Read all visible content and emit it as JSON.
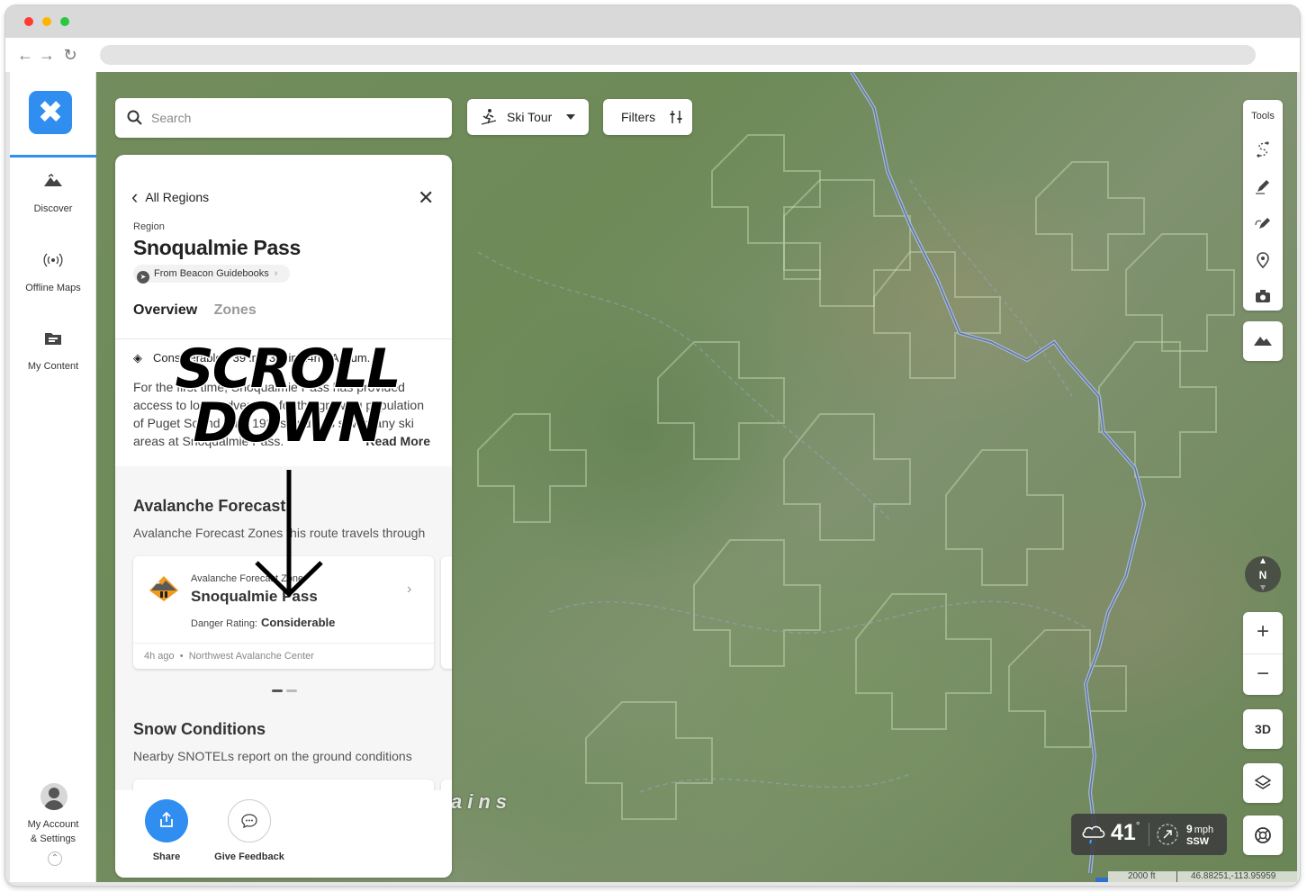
{
  "sidebar": {
    "items": [
      {
        "label": "Discover",
        "icon": "mountain-icon"
      },
      {
        "label": "Offline Maps",
        "icon": "signal-icon"
      },
      {
        "label": "My Content",
        "icon": "folder-icon"
      }
    ],
    "account_label_1": "My Account",
    "account_label_2": "& Settings"
  },
  "search": {
    "placeholder": "Search"
  },
  "activity_filter": {
    "label": "Ski Tour"
  },
  "filters": {
    "label": "Filters"
  },
  "panel": {
    "back_label": "All Regions",
    "region_caption": "Region",
    "title": "Snoqualmie Pass",
    "source": "From Beacon Guidebooks",
    "tabs": [
      {
        "label": "Overview"
      },
      {
        "label": "Zones"
      }
    ],
    "stats": {
      "danger": "Considerable",
      "snow": "39 in",
      "new_snow": "3.4 in 24h",
      "trend": "Accum."
    },
    "description": "For the first time, Snoqualmie Pass has provided access to local adventure for the growing population of Puget Sound. The 1920s and 30s saw many ski areas at Snoqualmie Pass.",
    "read_more": "Read More",
    "avalanche": {
      "title": "Avalanche Forecast",
      "subtitle": "Avalanche Forecast Zones this route travels through",
      "card": {
        "caption": "Avalanche Forecast Zone",
        "name": "Snoqualmie Pass",
        "danger_label": "Danger Rating:",
        "danger_value": "Considerable",
        "time": "4h ago",
        "source": "Northwest Avalanche Center"
      }
    },
    "snow": {
      "title": "Snow Conditions",
      "subtitle": "Nearby SNOTELs report on the ground conditions"
    },
    "footer": {
      "share": "Share",
      "feedback": "Give Feedback"
    }
  },
  "overlay": {
    "line1": "SCROLL",
    "line2": "DOWN"
  },
  "tools": {
    "label": "Tools",
    "layers_3d": "3D"
  },
  "compass": {
    "label": "N"
  },
  "weather": {
    "temp": "41",
    "degree": "°",
    "wind_speed": "9",
    "wind_unit": "mph",
    "wind_dir": "SSW"
  },
  "map": {
    "label": "ains",
    "scale": "2000 ft",
    "coords": "46.88251,-113.95959"
  },
  "colors": {
    "accent": "#2f8ef0",
    "danger_orange": "#f29a1f"
  }
}
